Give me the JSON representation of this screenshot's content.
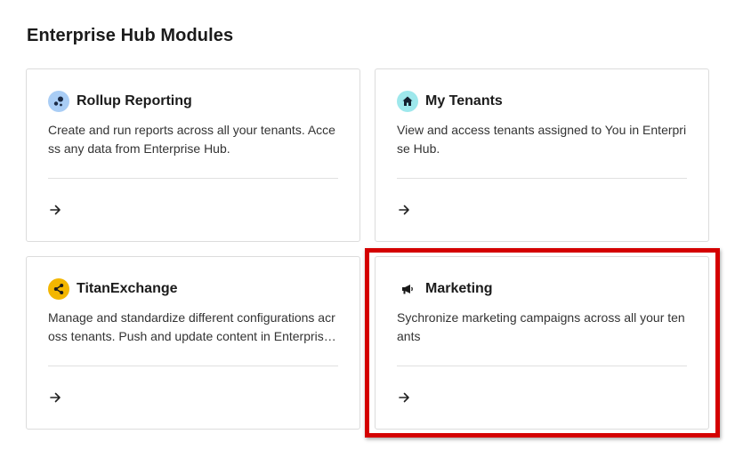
{
  "page": {
    "title": "Enterprise Hub Modules"
  },
  "colors": {
    "rollup_icon_bg": "#a9cdf5",
    "tenants_icon_bg": "#9ee8ec",
    "titan_icon_bg": "#f3b600",
    "highlight": "#d40000"
  },
  "cards": [
    {
      "title": "Rollup Reporting",
      "icon": "rollup-reporting-icon",
      "description": "Create and run reports across all your tenants. Access any data from Enterprise Hub.",
      "link_icon": "arrow-right-icon"
    },
    {
      "title": "My Tenants",
      "icon": "home-icon",
      "description": "View and access tenants assigned to You in Enterprise Hub.",
      "link_icon": "arrow-right-icon"
    },
    {
      "title": "TitanExchange",
      "icon": "share-icon",
      "description": "Manage and standardize different configurations across tenants. Push and update content in Enterprise Hub.",
      "link_icon": "arrow-right-icon"
    },
    {
      "title": "Marketing",
      "icon": "megaphone-icon",
      "description": "Sychronize marketing campaigns across all your tenants",
      "link_icon": "arrow-right-icon"
    }
  ]
}
